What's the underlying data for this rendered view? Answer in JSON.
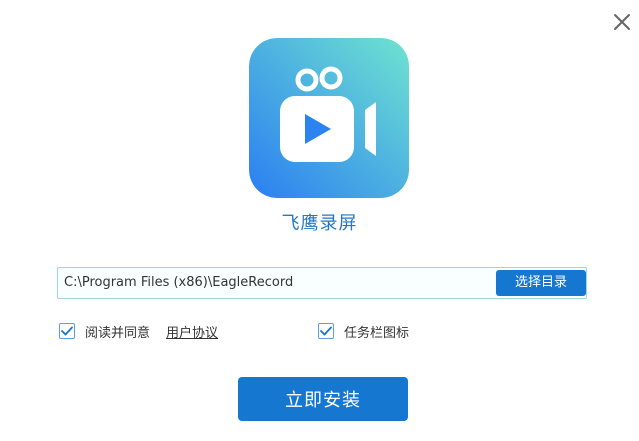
{
  "app": {
    "name": "飞鹰录屏",
    "logo_icon": "video-camera-icon"
  },
  "install_path": {
    "value": "C:\\Program Files (x86)\\EagleRecord",
    "browse_label": "选择目录"
  },
  "options": {
    "agree_label": "阅读并同意",
    "agree_checked": true,
    "agreement_link": "用户协议",
    "taskbar_label": "任务栏图标",
    "taskbar_checked": true
  },
  "install_button": "立即安装",
  "colors": {
    "accent": "#1677d1",
    "title": "#2377c9",
    "logo_gradient_start": "#6fe3d0",
    "logo_gradient_end": "#2a7ef2"
  }
}
